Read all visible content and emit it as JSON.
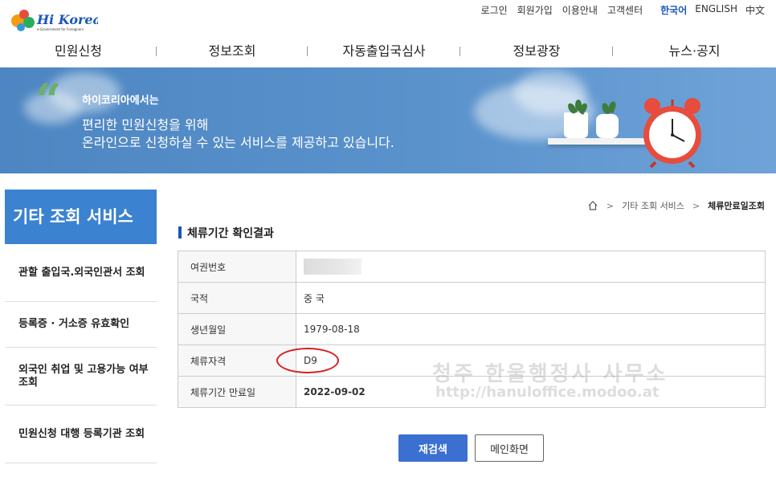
{
  "logo": {
    "text": "Hi Korea",
    "tagline": "e-Government for Foreigners"
  },
  "util_menu": {
    "login": "로그인",
    "join": "회원가입",
    "guide": "이용안내",
    "support": "고객센터",
    "lang_ko": "한국어",
    "lang_en": "ENGLISH",
    "lang_zh": "中文"
  },
  "gnb": [
    {
      "label": "민원신청"
    },
    {
      "label": "정보조회"
    },
    {
      "label": "자동출입국심사"
    },
    {
      "label": "정보광장"
    },
    {
      "label": "뉴스·공지"
    }
  ],
  "banner": {
    "subtitle": "하이코리아에서는",
    "line1": "편리한 민원신청을 위해",
    "line2": "온라인으로 신청하실 수 있는 서비스를 제공하고 있습니다."
  },
  "sidebar": {
    "title": "기타 조회 서비스",
    "items": [
      {
        "label": "관할 출입국.외국인관서 조회"
      },
      {
        "label": "등록증 · 거소증 유효확인"
      },
      {
        "label": "외국인 취업 및 고용가능 여부 조회"
      },
      {
        "label": "민원신청 대행 등록기관 조회"
      }
    ]
  },
  "breadcrumb": {
    "level1": "기타 조회 서비스",
    "current": "체류만료일조회"
  },
  "section_title": "체류기간 확인결과",
  "result": {
    "rows": [
      {
        "label": "여권번호",
        "value": ""
      },
      {
        "label": "국적",
        "value": "중 국"
      },
      {
        "label": "생년월일",
        "value": "1979-08-18"
      },
      {
        "label": "체류자격",
        "value": "D9"
      },
      {
        "label": "체류기간 만료일",
        "value": "2022-09-02"
      }
    ]
  },
  "watermark": {
    "line1": "청주 한울행정사 사무소",
    "line2": "http://hanuloffice.modoo.at"
  },
  "buttons": {
    "search": "재검색",
    "main": "메인화면"
  },
  "colors": {
    "primary": "#3b82d1",
    "banner": "#5a92cc",
    "button": "#3b6fd1",
    "highlight_circle": "#d62020"
  }
}
